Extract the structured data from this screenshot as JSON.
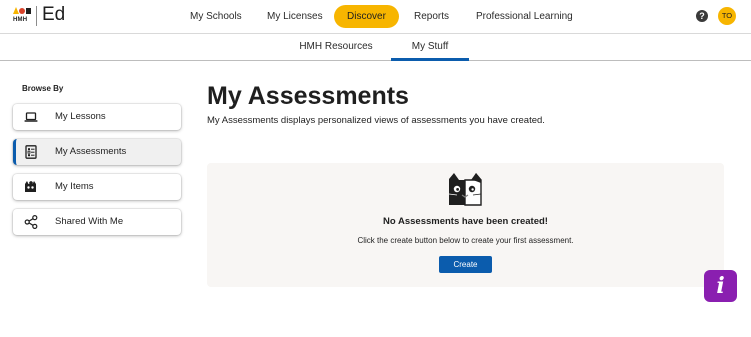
{
  "header": {
    "logo_text": "HMH",
    "brand": "Ed",
    "nav": [
      {
        "label": "My Schools"
      },
      {
        "label": "My Licenses"
      },
      {
        "label": "Discover",
        "active": true
      },
      {
        "label": "Reports"
      },
      {
        "label": "Professional Learning"
      }
    ],
    "help_glyph": "?",
    "avatar_initials": "TO"
  },
  "subnav": {
    "tabs": [
      {
        "label": "HMH Resources"
      },
      {
        "label": "My Stuff",
        "active": true
      }
    ]
  },
  "sidebar": {
    "heading": "Browse By",
    "items": [
      {
        "label": "My Lessons",
        "icon": "laptop-icon"
      },
      {
        "label": "My Assessments",
        "icon": "checklist-icon",
        "active": true
      },
      {
        "label": "My Items",
        "icon": "puzzle-icon"
      },
      {
        "label": "Shared With Me",
        "icon": "share-icon"
      }
    ]
  },
  "main": {
    "title": "My Assessments",
    "description": "My Assessments displays personalized views of assessments you have created.",
    "empty_state": {
      "icon": "cat-illustration-icon",
      "title": "No Assessments have been created!",
      "description": "Click the create button below to create your first assessment.",
      "button_label": "Create"
    }
  },
  "fab": {
    "glyph": "i",
    "icon": "info-icon"
  },
  "colors": {
    "accent_yellow": "#f7b500",
    "primary_blue": "#0b5cad",
    "fab_purple": "#8a1fb0",
    "panel_bg": "#f8f6f4"
  }
}
